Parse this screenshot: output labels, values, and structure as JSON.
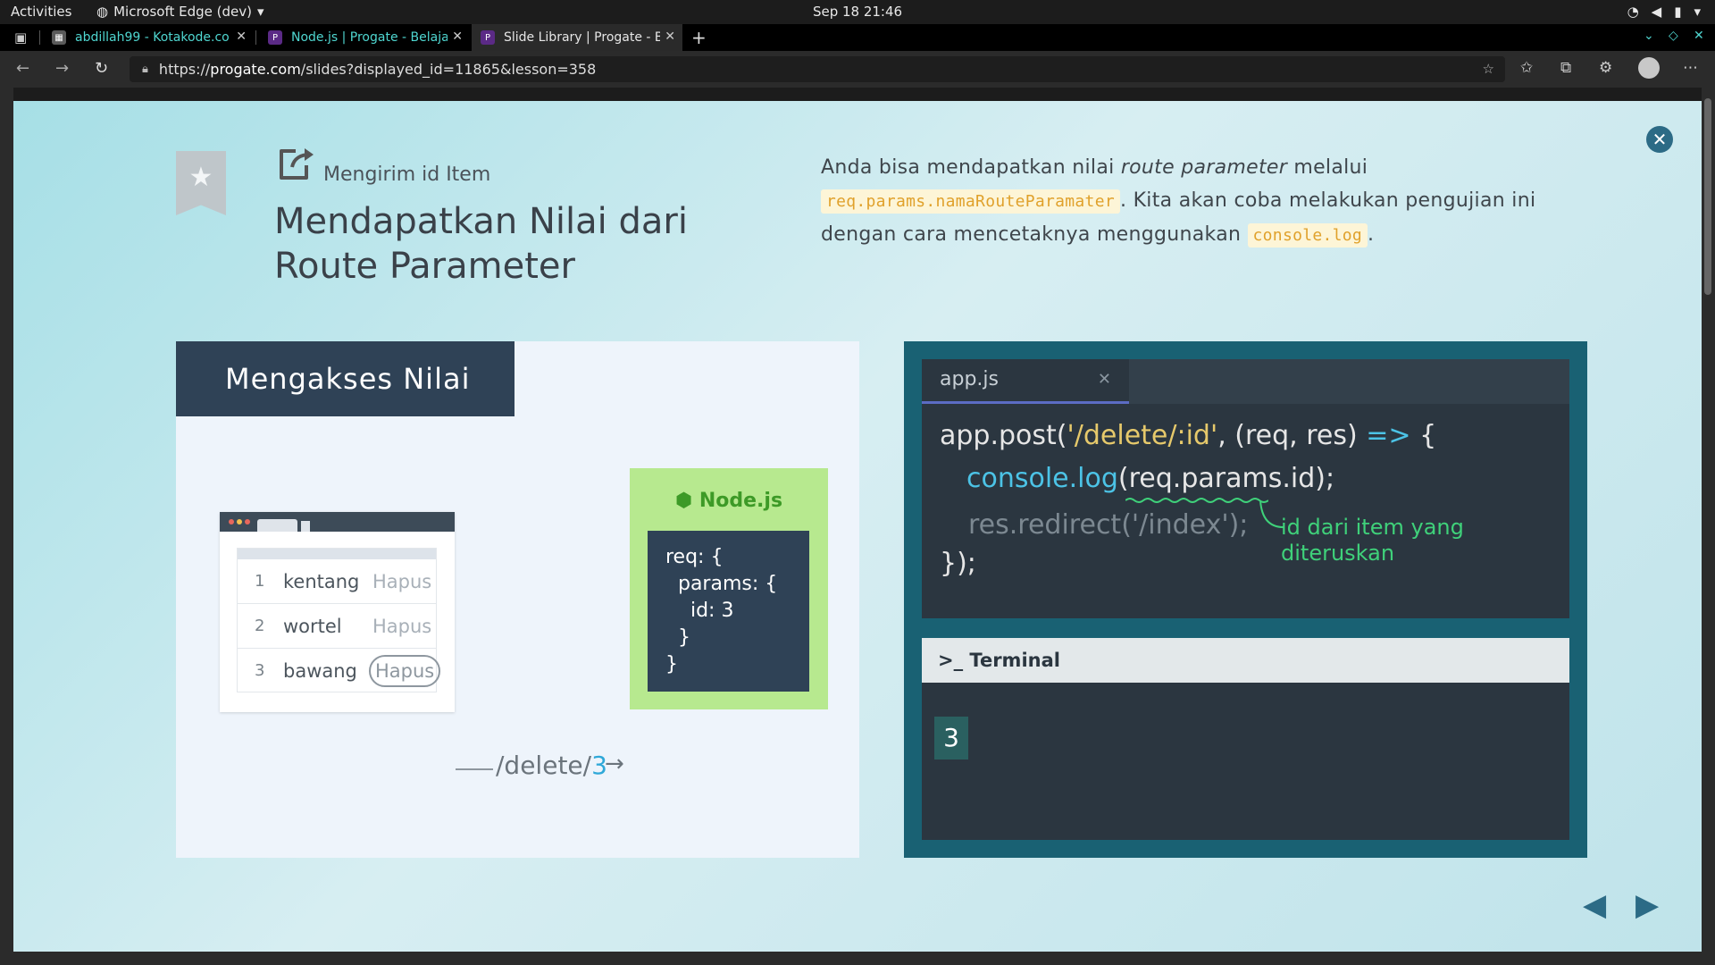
{
  "os_bar": {
    "activities": "Activities",
    "app_name": "Microsoft Edge (dev)",
    "clock": "Sep 18  21:46"
  },
  "tabs": [
    {
      "title": "abdillah99 - Kotakode.co",
      "favicon": "table-icon"
    },
    {
      "title": "Node.js | Progate - Belaja",
      "favicon": "progate-icon"
    },
    {
      "title": "Slide Library | Progate - B",
      "favicon": "progate-icon"
    }
  ],
  "address": {
    "scheme": "https://",
    "host": "progate.com",
    "path": "/slides?displayed_id=11865&lesson=358"
  },
  "slide": {
    "subtitle": "Mengirim id Item",
    "title": "Mendapatkan Nilai dari Route Parameter",
    "desc": {
      "p1": "Anda bisa mendapatkan nilai ",
      "em": "route parameter",
      "p2": " melalui",
      "code1": "req.params.namaRouteParamater",
      "p3": ". Kita akan coba melakukan pengujian ini dengan cara mencetaknya menggunakan ",
      "code2": "console.log",
      "p4": "."
    },
    "left_heading": "Mengakses Nilai",
    "list": [
      {
        "num": "1",
        "name": "kentang",
        "action": "Hapus"
      },
      {
        "num": "2",
        "name": "wortel",
        "action": "Hapus"
      },
      {
        "num": "3",
        "name": "bawang",
        "action": "Hapus"
      }
    ],
    "route_prefix": "/delete/",
    "route_id": "3",
    "node_title": "Node.js",
    "node_code": "req: {\n  params: {\n    id: 3\n  }\n}",
    "editor_tab": "app.js",
    "code": {
      "l1a": "app.post(",
      "l1b": "'/delete/:id'",
      "l1c": ", (req, res) ",
      "l1d": "=>",
      "l1e": " {",
      "l2a": "console.log",
      "l2b": "(req.params.id);",
      "l3": "res.redirect('/index');",
      "l4": "});"
    },
    "annotation": "id dari item yang diteruskan",
    "terminal_title": "Terminal",
    "terminal_output": "3"
  }
}
